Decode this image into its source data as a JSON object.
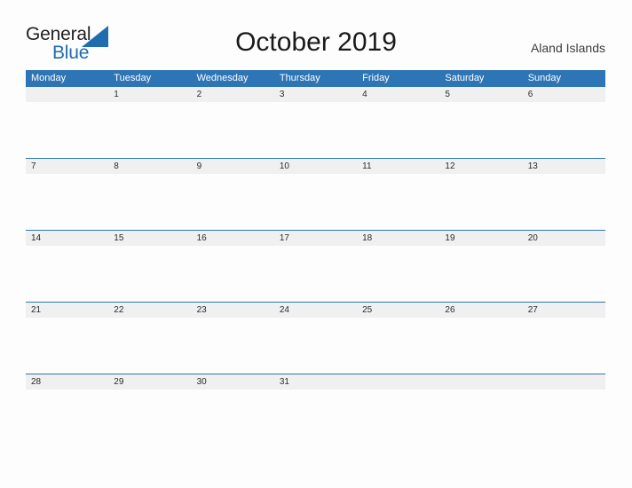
{
  "brand": {
    "name_part_1": "General",
    "name_part_2": "Blue",
    "triangle_color": "#1f6cb0",
    "text_color_1": "#231f20",
    "text_color_2": "#1f6cb0"
  },
  "header": {
    "title": "October 2019",
    "month": "October",
    "year": "2019",
    "location": "Aland Islands"
  },
  "colors": {
    "header_bar": "#2e75b6",
    "row_band": "#f0f0f0",
    "row_divider": "#2e75b6",
    "page_background": "#fdfdfd",
    "weekday_text": "#ffffff",
    "date_text": "#2b2b2b",
    "title_text": "#1a1a1a",
    "location_text": "#3d3d3d"
  },
  "calendar": {
    "weekdays": [
      "Monday",
      "Tuesday",
      "Wednesday",
      "Thursday",
      "Friday",
      "Saturday",
      "Sunday"
    ],
    "weeks": [
      {
        "days": [
          "",
          "1",
          "2",
          "3",
          "4",
          "5",
          "6"
        ]
      },
      {
        "days": [
          "7",
          "8",
          "9",
          "10",
          "11",
          "12",
          "13"
        ]
      },
      {
        "days": [
          "14",
          "15",
          "16",
          "17",
          "18",
          "19",
          "20"
        ]
      },
      {
        "days": [
          "21",
          "22",
          "23",
          "24",
          "25",
          "26",
          "27"
        ]
      },
      {
        "days": [
          "28",
          "29",
          "30",
          "31",
          "",
          "",
          ""
        ]
      }
    ]
  }
}
